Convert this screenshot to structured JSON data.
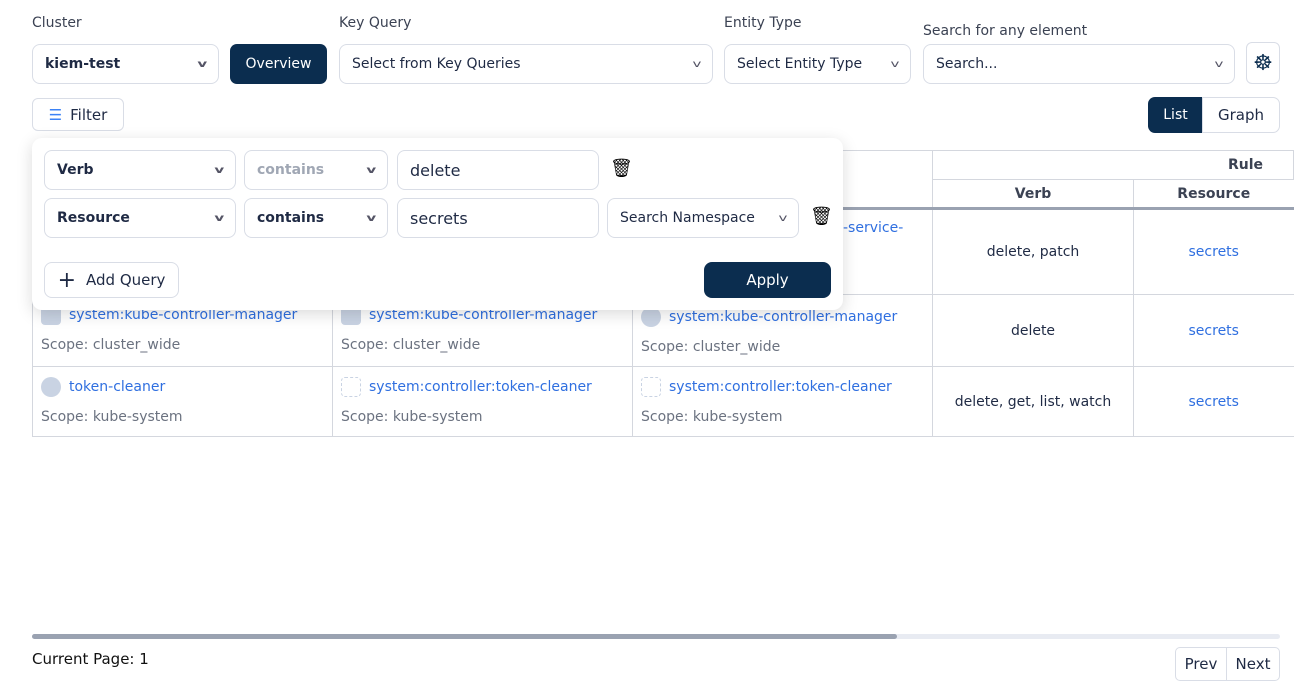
{
  "header": {
    "cluster_label": "Cluster",
    "cluster_value": "kiem-test",
    "overview_label": "Overview",
    "key_query_label": "Key Query",
    "key_query_value": "Select from Key Queries",
    "entity_type_label": "Entity Type",
    "entity_type_value": "Select Entity Type",
    "search_label": "Search for any element",
    "search_value": "Search...",
    "kubernetes_icon": "helm-wheel-icon"
  },
  "filter_label": "Filter",
  "view_toggle": {
    "list": "List",
    "graph": "Graph",
    "active": "List"
  },
  "filter_panel": {
    "rows": [
      {
        "field": "Verb",
        "operator": "contains",
        "value": "delete"
      },
      {
        "field": "Resource",
        "operator": "contains",
        "value": "secrets",
        "namespace": "Search Namespace"
      }
    ],
    "add_query": "Add Query",
    "apply": "Apply"
  },
  "table": {
    "group_header": "Rule",
    "verb_header": "Verb",
    "resource_header": "Resource",
    "rows": [
      {
        "c3": "-service-",
        "verb": "delete, patch",
        "resource": "secrets"
      },
      {
        "c1": "system:kube-controller-manager",
        "c1_scope": "Scope: cluster_wide",
        "c2": "system:kube-controller-manager",
        "c2_scope": "Scope: cluster_wide",
        "c3": "system:kube-controller-manager",
        "c3_scope": "Scope: cluster_wide",
        "verb": "delete",
        "resource": "secrets"
      },
      {
        "c1": "token-cleaner",
        "c1_scope": "Scope: kube-system",
        "c2": "system:controller:token-cleaner",
        "c2_scope": "Scope: kube-system",
        "c3": "system:controller:token-cleaner",
        "c3_scope": "Scope: kube-system",
        "verb": "delete, get, list, watch",
        "resource": "secrets"
      }
    ]
  },
  "pagination": {
    "current": "Current Page: 1",
    "prev": "Prev",
    "next": "Next"
  },
  "colors": {
    "primary": "#0b2d4f",
    "link": "#2f6fe0"
  }
}
